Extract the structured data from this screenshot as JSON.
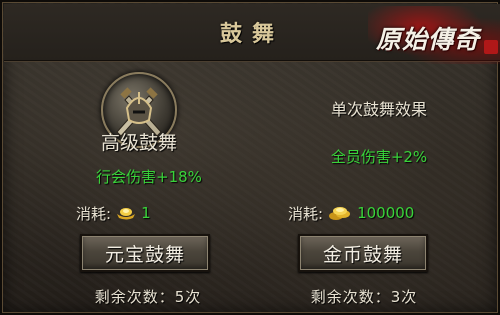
{
  "title": "鼓舞",
  "logo_text": "原始傳奇",
  "left": {
    "skill_name": "高级鼓舞",
    "effect": "行会伤害+18%",
    "cost_label": "消耗:",
    "cost_icon": "gold-ingot-icon",
    "cost_value": "1",
    "button_label": "元宝鼓舞",
    "remaining": "剩余次数：5次"
  },
  "right": {
    "heading": "单次鼓舞效果",
    "effect": "全员伤害+2%",
    "cost_label": "消耗:",
    "cost_icon": "gold-coins-icon",
    "cost_value": "100000",
    "button_label": "金币鼓舞",
    "remaining": "剩余次数：3次"
  },
  "colors": {
    "effect_green": "#39d33a",
    "title_gold": "#d8c79a"
  }
}
